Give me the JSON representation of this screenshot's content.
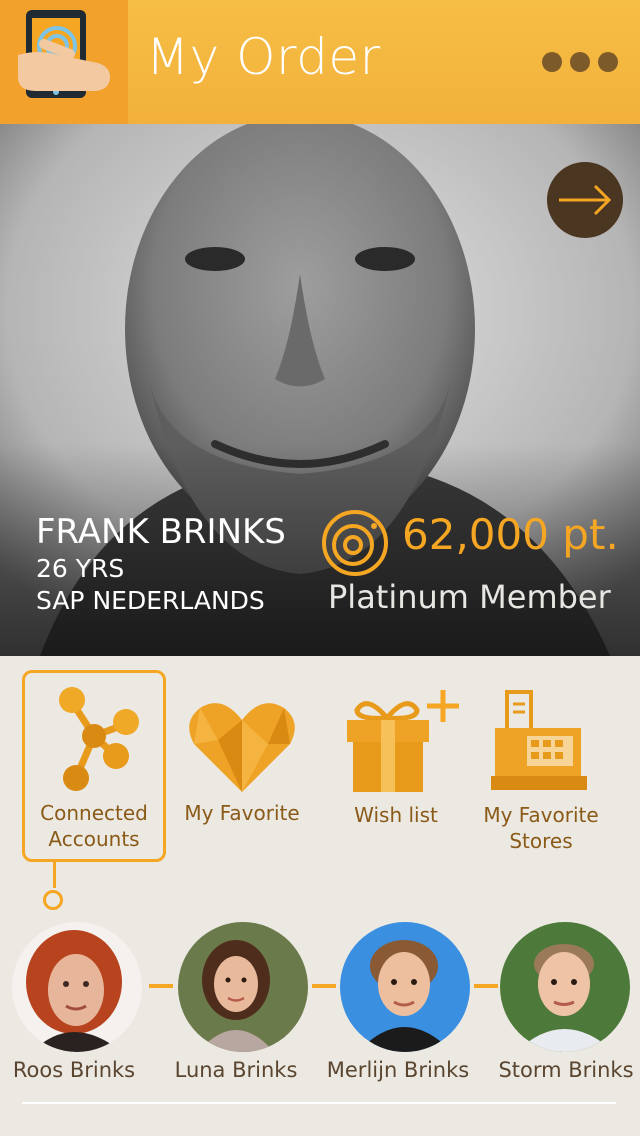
{
  "header": {
    "title": "My Order"
  },
  "profile": {
    "name": "FRANK BRINKS",
    "age": "26 YRS",
    "company": "SAP NEDERLANDS",
    "points": "62,000 pt.",
    "membership": "Platinum Member"
  },
  "menu": [
    {
      "label_1": "Connected",
      "label_2": "Accounts"
    },
    {
      "label_1": "My Favorite"
    },
    {
      "label_1": "Wish list"
    },
    {
      "label_1": "My Favorite",
      "label_2": "Stores"
    }
  ],
  "people": [
    {
      "name": "Roos Brinks"
    },
    {
      "name": "Luna Brinks"
    },
    {
      "name": "Merlijn Brinks"
    },
    {
      "name": "Storm Brinks"
    }
  ],
  "colors": {
    "accent": "#f5a623",
    "header": "#f2b13c",
    "brown": "#8a5a18"
  }
}
